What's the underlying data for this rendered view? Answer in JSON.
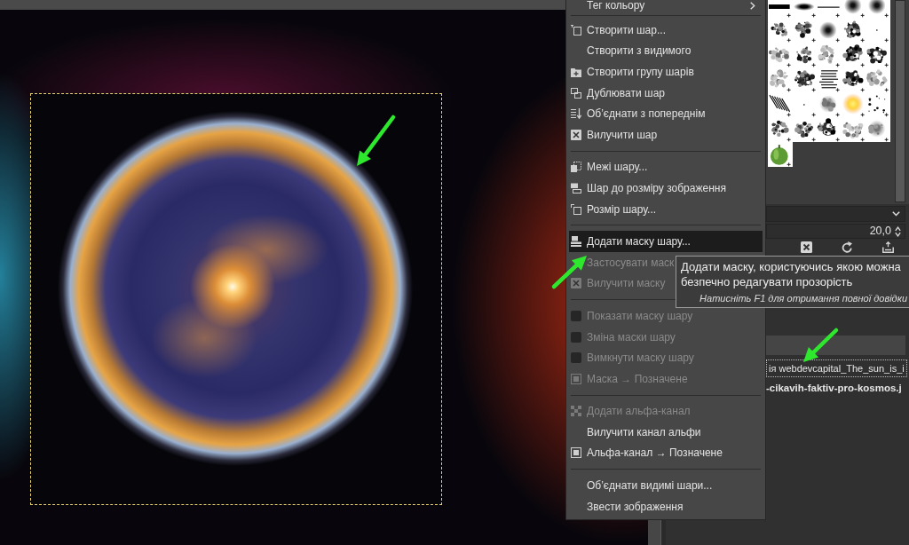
{
  "canvas": {
    "has_selection": true
  },
  "context_menu": {
    "items": [
      {
        "kind": "submenu",
        "label": "Тег кольору",
        "disabled": false,
        "selected": false
      },
      {
        "kind": "separator"
      },
      {
        "kind": "action",
        "label": "Створити шар...",
        "disabled": false,
        "selected": false
      },
      {
        "kind": "action",
        "label": "Створити з видимого",
        "disabled": false,
        "selected": false
      },
      {
        "kind": "action",
        "label": "Створити групу шарів",
        "disabled": false,
        "selected": false
      },
      {
        "kind": "action",
        "label": "Дублювати шар",
        "disabled": false,
        "selected": false
      },
      {
        "kind": "action",
        "label": "Об’єднати з попереднім",
        "disabled": false,
        "selected": false
      },
      {
        "kind": "action",
        "label": "Вилучити шар",
        "disabled": false,
        "selected": false
      },
      {
        "kind": "separator"
      },
      {
        "kind": "action",
        "label": "Межі шару...",
        "disabled": false,
        "selected": false
      },
      {
        "kind": "action",
        "label": "Шар до розміру зображення",
        "disabled": false,
        "selected": false
      },
      {
        "kind": "action",
        "label": "Розмір шару...",
        "disabled": false,
        "selected": false
      },
      {
        "kind": "separator"
      },
      {
        "kind": "action",
        "label": "Додати маску шару...",
        "disabled": false,
        "selected": true
      },
      {
        "kind": "action",
        "label": "Застосувати маск",
        "disabled": true,
        "selected": false
      },
      {
        "kind": "action",
        "label": "Вилучити маску",
        "disabled": true,
        "selected": false
      },
      {
        "kind": "separator"
      },
      {
        "kind": "toggle",
        "label": "Показати маску шару",
        "disabled": true,
        "selected": false,
        "checked": false
      },
      {
        "kind": "toggle",
        "label": "Зміна маски шару",
        "disabled": true,
        "selected": false,
        "checked": false
      },
      {
        "kind": "toggle",
        "label": "Вимкнути маску шару",
        "disabled": true,
        "selected": false,
        "checked": false
      },
      {
        "kind": "action",
        "label": "Маска → Позначене",
        "disabled": true,
        "selected": false
      },
      {
        "kind": "separator"
      },
      {
        "kind": "action",
        "label": "Додати альфа-канал",
        "disabled": true,
        "selected": false
      },
      {
        "kind": "action",
        "label": "Вилучити канал альфи",
        "disabled": false,
        "selected": false
      },
      {
        "kind": "action",
        "label": "Альфа-канал → Позначене",
        "disabled": false,
        "selected": false
      },
      {
        "kind": "separator"
      },
      {
        "kind": "action",
        "label": "Об’єднати видимі шари...",
        "disabled": false,
        "selected": false
      },
      {
        "kind": "action",
        "label": "Звести зображення",
        "disabled": false,
        "selected": false
      }
    ]
  },
  "tooltip": {
    "text": "Додати маску, користуючись якою можна безпечно редагувати прозорість",
    "hint": "Натисніть F1 для отримання повної довідки"
  },
  "brush_options": {
    "spacing": "20,0"
  },
  "layers_panel": {
    "layer": {
      "name": "ія webdevcapital_The_sun_is_i",
      "focused": true
    },
    "image_name": "-cikavih-faktiv-pro-kosmos.j"
  }
}
